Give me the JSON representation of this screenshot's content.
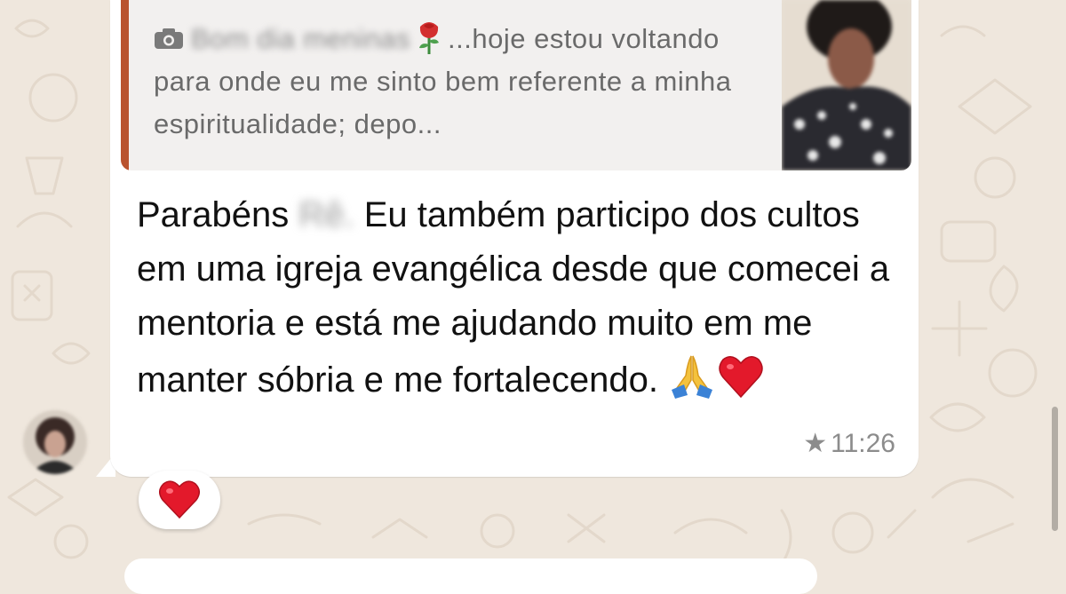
{
  "quoted_message": {
    "media_icon": "camera-icon",
    "sender_preview_blurred": "Bom dia meninas",
    "rose_emoji": "🌹",
    "text": "...hoje estou voltando para onde eu me sinto bem referente a minha espiritualidade; depo...",
    "accent_color": "#b9532f"
  },
  "message": {
    "prefix": "Parabéns",
    "name_blurred": "Rê.",
    "body": "Eu também participo dos cultos em uma igreja evangélica desde que comecei a mentoria e está me ajudando muito em me manter sóbria e me fortalecendo.",
    "emojis": "🙏❤️",
    "starred_icon": "star-icon",
    "time": "11:26"
  },
  "reaction": {
    "emoji": "❤️",
    "icon": "heart-icon"
  }
}
